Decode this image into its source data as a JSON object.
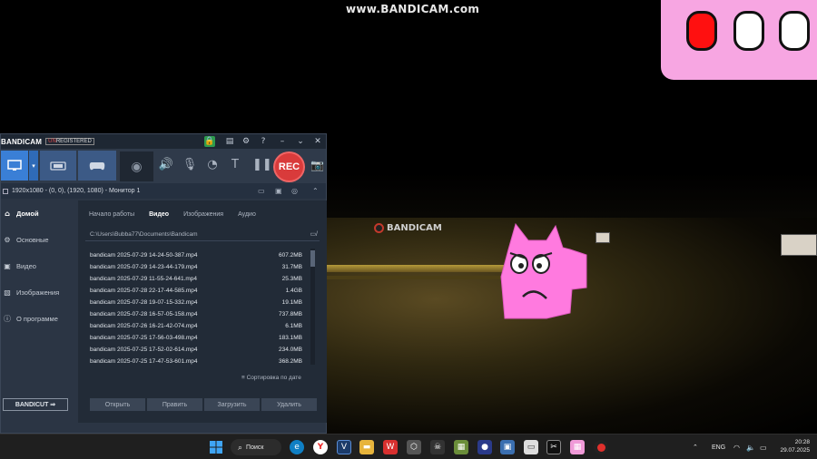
{
  "watermark": "www.BANDICAM.com",
  "game": {
    "overlay_logo": "BANDICAM",
    "colors": {
      "pink": "#f7a6e2",
      "red_button": "#ff0000"
    }
  },
  "bandicam": {
    "title": {
      "logo": "BANDICAM",
      "unregistered_prefix": "UN",
      "unregistered_rest": "REGISTERED",
      "controls": [
        "lock-icon",
        "folder-icon",
        "settings-icon",
        "help-icon",
        "minimize-icon",
        "close-icon"
      ]
    },
    "toolbar": {
      "modes": [
        "screen-mode",
        "device-mode",
        "game-mode"
      ],
      "rec_label": "REC"
    },
    "info_bar": {
      "text": "1920x1080 - (0, 0), (1920, 1080) - Монитор 1"
    },
    "sidebar": {
      "items": [
        {
          "label": "Домой",
          "icon": "home-icon",
          "active": true
        },
        {
          "label": "Основные",
          "icon": "gear-icon",
          "active": false
        },
        {
          "label": "Видео",
          "icon": "video-icon",
          "active": false
        },
        {
          "label": "Изображения",
          "icon": "image-icon",
          "active": false
        },
        {
          "label": "О программе",
          "icon": "info-icon",
          "active": false
        }
      ],
      "bandicut": "BANDICUT ⇒"
    },
    "tabs": [
      {
        "label": "Начало работы",
        "active": false
      },
      {
        "label": "Видео",
        "active": true
      },
      {
        "label": "Изображения",
        "active": false
      },
      {
        "label": "Аудио",
        "active": false
      }
    ],
    "path": "C:\\Users\\Bubba77\\Documents\\Bandicam",
    "files": [
      {
        "name": "bandicam 2025-07-29 14-24-50-387.mp4",
        "size": "607.2MB"
      },
      {
        "name": "bandicam 2025-07-29 14-23-44-179.mp4",
        "size": "31.7MB"
      },
      {
        "name": "bandicam 2025-07-29 11-55-24-641.mp4",
        "size": "25.3MB"
      },
      {
        "name": "bandicam 2025-07-28 22-17-44-585.mp4",
        "size": "1.4GB"
      },
      {
        "name": "bandicam 2025-07-28 19-07-15-332.mp4",
        "size": "19.1MB"
      },
      {
        "name": "bandicam 2025-07-28 16-57-05-158.mp4",
        "size": "737.8MB"
      },
      {
        "name": "bandicam 2025-07-26 16-21-42-074.mp4",
        "size": "6.1MB"
      },
      {
        "name": "bandicam 2025-07-25 17-56-03-498.mp4",
        "size": "183.1MB"
      },
      {
        "name": "bandicam 2025-07-25 17-52-02-614.mp4",
        "size": "234.0MB"
      },
      {
        "name": "bandicam 2025-07-25 17-47-53-601.mp4",
        "size": "368.2MB"
      }
    ],
    "sort_label": "Сортировка по дате",
    "buttons": [
      "Открыть",
      "Править",
      "Загрузить",
      "Удалить"
    ]
  },
  "taskbar": {
    "search_label": "Поиск",
    "apps": [
      "start-icon",
      "search-icon",
      "edge-icon",
      "yandex-icon",
      "v-app-icon",
      "explorer-icon",
      "wps-icon",
      "app-icon-1",
      "app-icon-2",
      "minecraft-icon",
      "app-icon-3",
      "app-icon-4",
      "app-icon-5",
      "capcut-icon",
      "pink-app-icon",
      "bandicam-taskbar-icon"
    ],
    "language": "ENG",
    "time": "20:28",
    "date": "29.07.2025"
  }
}
